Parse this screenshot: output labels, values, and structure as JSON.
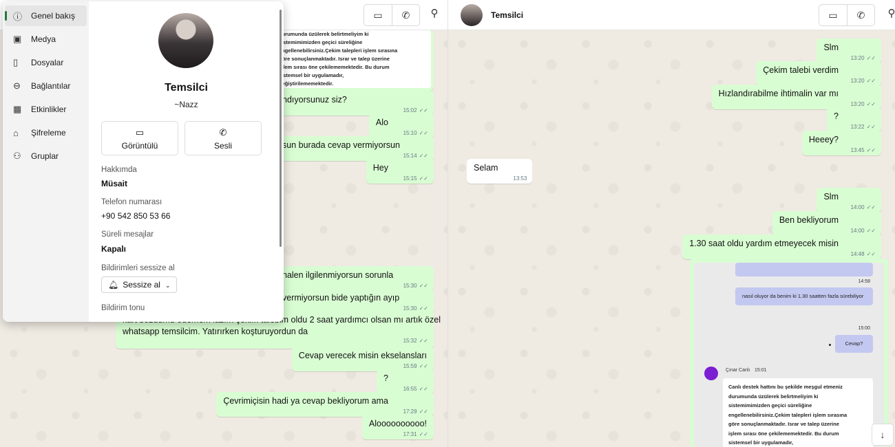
{
  "left_header": {
    "video_icon": "video-icon",
    "call_icon": "phone-icon",
    "search_icon": "search-icon"
  },
  "right_header": {
    "contact_name": "Temsilci"
  },
  "profile_panel": {
    "nav": [
      {
        "label": "Genel bakış",
        "icon": "info-icon"
      },
      {
        "label": "Medya",
        "icon": "image-icon"
      },
      {
        "label": "Dosyalar",
        "icon": "file-icon"
      },
      {
        "label": "Bağlantılar",
        "icon": "link-icon"
      },
      {
        "label": "Etkinlikler",
        "icon": "calendar-icon"
      },
      {
        "label": "Şifreleme",
        "icon": "lock-icon"
      },
      {
        "label": "Gruplar",
        "icon": "group-icon"
      }
    ],
    "name": "Temsilci",
    "nickname": "~Nazz",
    "video_label": "Görüntülü",
    "voice_label": "Sesli",
    "about_label": "Hakkımda",
    "about_value": "Müsait",
    "phone_label": "Telefon numarası",
    "phone_value": "+90 542 850 53 66",
    "disappearing_label": "Süreli mesajlar",
    "disappearing_value": "Kapalı",
    "mute_label": "Bildirimleri sessize al",
    "mute_button": "Sessize al",
    "tone_label": "Bildirim tonu"
  },
  "left_shot_lines": [
    "durumunda üzülerek belirtmeliyim ki",
    "sistemimimizden geçici süreliğine",
    "engellenebilirsiniz.Çekim talepleri işlem sırasına",
    "göre sonuçlanmaktadır. Israr ve talep üzerine",
    "işlem sırası öne çekilememektedir. Bu durum",
    "sistemsel bir uygulamadır,",
    "değiştirilememektedir."
  ],
  "left_messages": [
    {
      "text": "ndıyorsunuz siz?",
      "time": "15:02"
    },
    {
      "text": "Alo",
      "time": "15:10"
    },
    {
      "text": "sun burada cevap vermiyorsun",
      "time": "15:14"
    },
    {
      "text": "Hey",
      "time": "15:15"
    },
    {
      "text": "halen ilgilenmiyorsun sorunla",
      "time": "15:30"
    },
    {
      "text": "vermiyorsun bide yaptığın ayıp",
      "time": "15:30"
    },
    {
      "text": "kart bozdumu ödemem lazım çekim talebim oldu 2 saat yardımcı olsan mı artık özel",
      "text2": "whatsapp temsilcim. Yatırırken koşturuyordun da",
      "time": "15:32"
    },
    {
      "text": "Cevap verecek misin ekselansları",
      "time": "15:59"
    },
    {
      "text": "?",
      "time": "16:55"
    },
    {
      "text": "Çevrimiçisin hadi ya cevap bekliyorum ama",
      "time": "17:29"
    },
    {
      "text": "Aloooooooooo!",
      "time": "17:31"
    }
  ],
  "right_messages": [
    {
      "text": "Slm",
      "time": "13:20"
    },
    {
      "text": "Çekim talebi verdim",
      "time": "13:20"
    },
    {
      "text": "Hızlandırabilme ihtimalin var mı",
      "time": "13:20"
    },
    {
      "text": "?",
      "time": "13:22"
    },
    {
      "text": "Heeey?",
      "time": "13:45"
    },
    {
      "text": "Selam",
      "time": "13:53"
    },
    {
      "text": "Slm",
      "time": "14:00"
    },
    {
      "text": "Ben bekliyorum",
      "time": "14:00"
    },
    {
      "text": "1.30 saat oldu yardım etmeyecek misin",
      "time": "14:48"
    }
  ],
  "right_shot": {
    "time1": "14:58",
    "bubble1": "nasıl oluyor da benim ki 1.30 saatten fazla sürebiliyor",
    "time2": "15:00",
    "bubble2": "Cevap?",
    "agent_name": "Çınar Canlı",
    "agent_time": "15:01",
    "agent_lines": [
      "Canlı destek hattını bu şekilde meşgul etmeniz",
      "durumunda üzülerek belirtmeliyim ki",
      "sistemimimizden geçici süreliğine",
      "engellenebilirsiniz.Çekim talepleri işlem sırasına",
      "göre sonuçlanmaktadır. Israr ve talep üzerine",
      "işlem sırası öne çekilememektedir. Bu durum",
      "sistemsel bir uygulamadır,"
    ]
  }
}
